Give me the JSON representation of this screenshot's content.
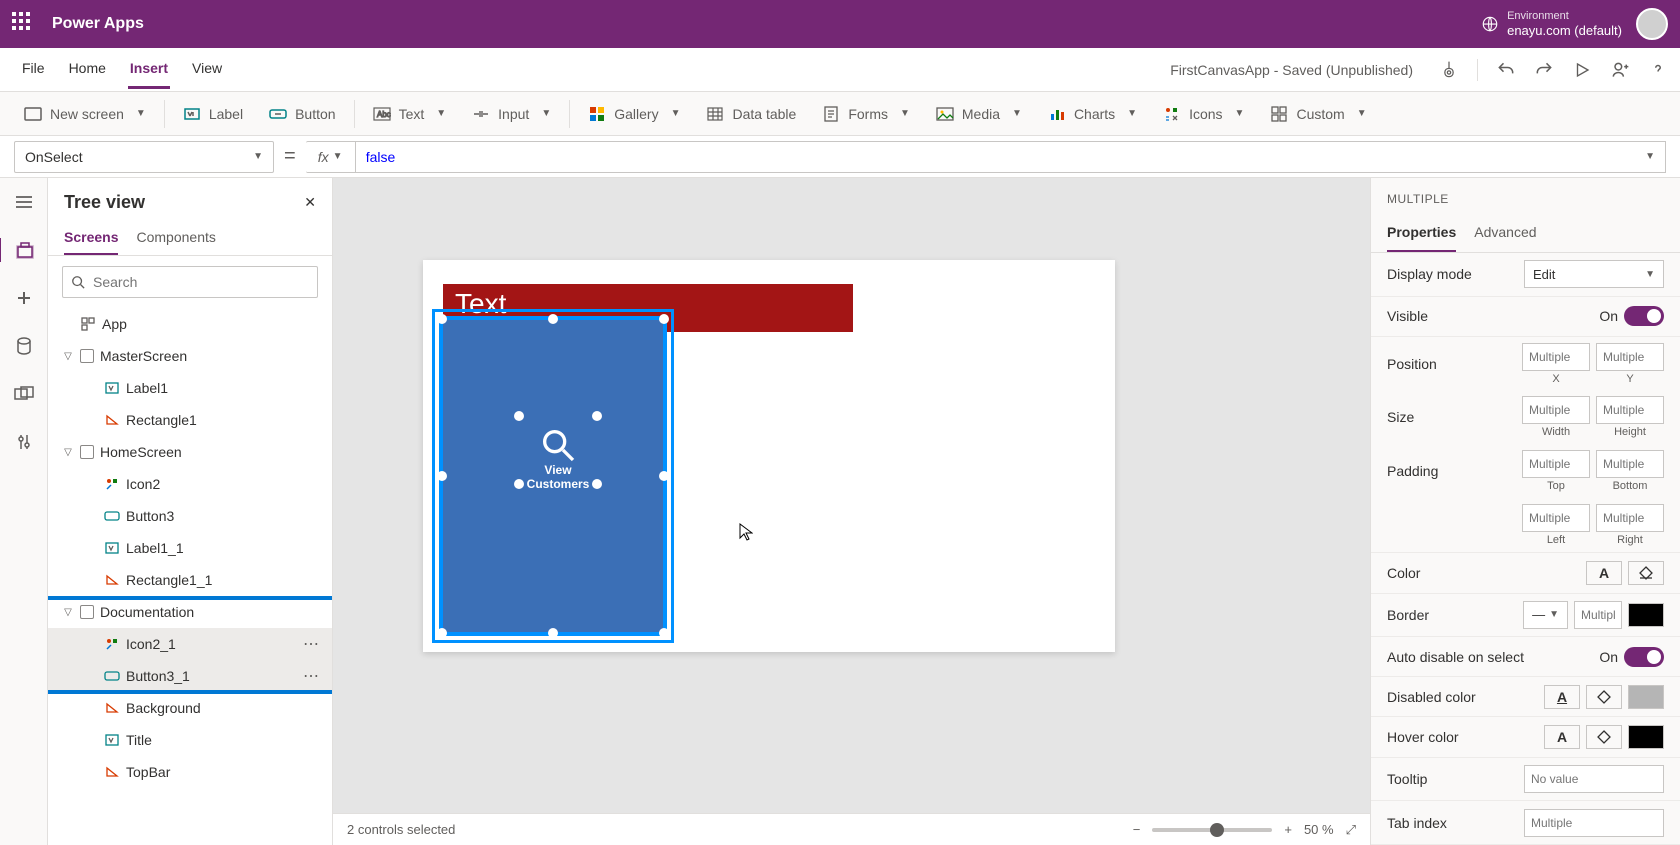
{
  "header": {
    "appName": "Power Apps",
    "envLabel": "Environment",
    "envName": "enayu.com (default)"
  },
  "menuBar": {
    "items": [
      "File",
      "Home",
      "Insert",
      "View"
    ],
    "activeIndex": 2,
    "docTitle": "FirstCanvasApp - Saved (Unpublished)"
  },
  "ribbon": {
    "newScreen": "New screen",
    "label": "Label",
    "button": "Button",
    "text": "Text",
    "input": "Input",
    "gallery": "Gallery",
    "dataTable": "Data table",
    "forms": "Forms",
    "media": "Media",
    "charts": "Charts",
    "icons": "Icons",
    "custom": "Custom"
  },
  "formulaBar": {
    "property": "OnSelect",
    "fx": "fx",
    "value": "false"
  },
  "treePanel": {
    "title": "Tree view",
    "tabs": [
      "Screens",
      "Components"
    ],
    "activeTab": 0,
    "searchPlaceholder": "Search",
    "items": {
      "app": "App",
      "masterScreen": "MasterScreen",
      "label1": "Label1",
      "rectangle1": "Rectangle1",
      "homeScreen": "HomeScreen",
      "icon2": "Icon2",
      "button3": "Button3",
      "label1_1": "Label1_1",
      "rectangle1_1": "Rectangle1_1",
      "documentation": "Documentation",
      "icon2_1": "Icon2_1",
      "button3_1": "Button3_1",
      "background": "Background",
      "title": "Title",
      "topBar": "TopBar"
    }
  },
  "canvas": {
    "redBarText": "Text",
    "blueLabel": "View Customers"
  },
  "statusBar": {
    "selection": "2 controls selected",
    "zoom": "50  %"
  },
  "propsPanel": {
    "heading": "MULTIPLE",
    "tabs": [
      "Properties",
      "Advanced"
    ],
    "activeTab": 0,
    "displayMode": {
      "label": "Display mode",
      "value": "Edit"
    },
    "visible": {
      "label": "Visible",
      "on": "On"
    },
    "position": {
      "label": "Position",
      "x": "X",
      "y": "Y",
      "placeholder": "Multiple"
    },
    "size": {
      "label": "Size",
      "w": "Width",
      "h": "Height",
      "placeholder": "Multiple"
    },
    "padding": {
      "label": "Padding",
      "top": "Top",
      "bottom": "Bottom",
      "left": "Left",
      "right": "Right",
      "placeholder": "Multiple"
    },
    "color": {
      "label": "Color"
    },
    "border": {
      "label": "Border",
      "placeholder": "Multipl"
    },
    "autoDisable": {
      "label": "Auto disable on select",
      "on": "On"
    },
    "disabledColor": {
      "label": "Disabled color"
    },
    "hoverColor": {
      "label": "Hover color"
    },
    "tooltip": {
      "label": "Tooltip",
      "placeholder": "No value"
    },
    "tabIndex": {
      "label": "Tab index",
      "placeholder": "Multiple"
    }
  }
}
